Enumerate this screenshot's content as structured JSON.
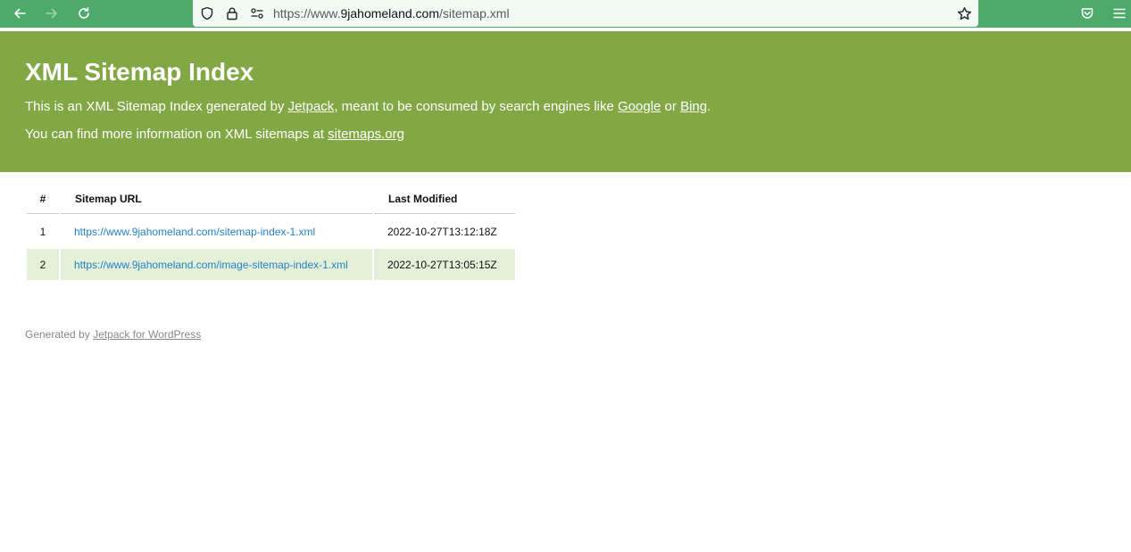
{
  "browser": {
    "url_scheme": "https://www.",
    "url_host": "9jahomeland.com",
    "url_path": "/sitemap.xml"
  },
  "header": {
    "title": "XML Sitemap Index",
    "line1_prefix": "This is an XML Sitemap Index generated by ",
    "line1_link_jetpack": "Jetpack",
    "line1_middle": ", meant to be consumed by search engines like ",
    "line1_link_google": "Google",
    "line1_or": " or ",
    "line1_link_bing": "Bing",
    "line1_suffix": ".",
    "line2_prefix": "You can find more information on XML sitemaps at ",
    "line2_link": "sitemaps.org"
  },
  "table": {
    "columns": [
      "#",
      "Sitemap URL",
      "Last Modified"
    ],
    "rows": [
      {
        "num": "1",
        "url": "https://www.9jahomeland.com/sitemap-index-1.xml",
        "modified": "2022-10-27T13:12:18Z"
      },
      {
        "num": "2",
        "url": "https://www.9jahomeland.com/image-sitemap-index-1.xml",
        "modified": "2022-10-27T13:05:15Z"
      }
    ]
  },
  "footer": {
    "prefix": "Generated by ",
    "link": "Jetpack for WordPress"
  },
  "colors": {
    "toolbar": "#4daa6a",
    "header": "#82a845",
    "row_highlight": "#e5f0d8",
    "link": "#2580c3"
  },
  "icons": [
    "back-arrow-icon",
    "forward-arrow-icon",
    "reload-icon",
    "shield-icon",
    "lock-icon",
    "permissions-icon",
    "star-icon",
    "pocket-icon",
    "menu-icon"
  ]
}
